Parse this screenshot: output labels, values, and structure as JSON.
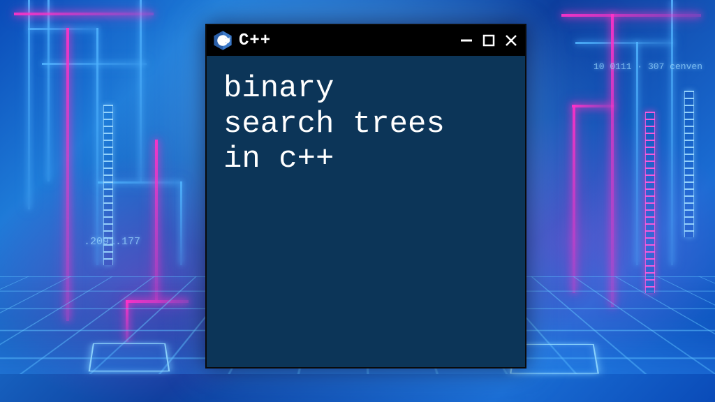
{
  "window": {
    "title": "C++",
    "icon": "cpp-icon",
    "controls": {
      "minimize": "minimize",
      "maximize": "maximize",
      "close": "close"
    }
  },
  "content": {
    "line1": "binary",
    "line2": "search trees",
    "line3": "in c++"
  },
  "background": {
    "deco_right": "10 0111 · 307  cenven",
    "deco_left": ".2091.177"
  }
}
